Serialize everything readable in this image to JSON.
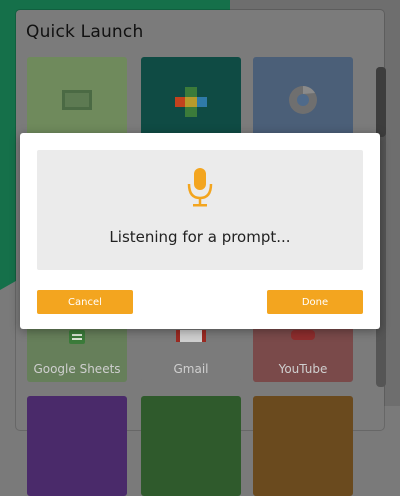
{
  "quick_launch": {
    "title": "Quick Launch",
    "tiles": [
      {
        "label": "",
        "icon": "slides-icon",
        "color": "#6f8a5c"
      },
      {
        "label": "",
        "icon": "plus-logo-icon",
        "color": "#0f4b44"
      },
      {
        "label": "",
        "icon": "chrome-icon",
        "color": "#4b5f78"
      },
      {
        "label": "Google Sheets",
        "icon": "sheets-icon",
        "color": "#667f5a"
      },
      {
        "label": "Gmail",
        "icon": "gmail-icon",
        "color": "#7b7b7b"
      },
      {
        "label": "YouTube",
        "icon": "youtube-icon",
        "color": "#7a4a4a"
      }
    ]
  },
  "dialog": {
    "message": "Listening for a prompt...",
    "mic_icon": "microphone-icon",
    "accent_color": "#f3a51f",
    "cancel_label": "Cancel",
    "done_label": "Done"
  }
}
